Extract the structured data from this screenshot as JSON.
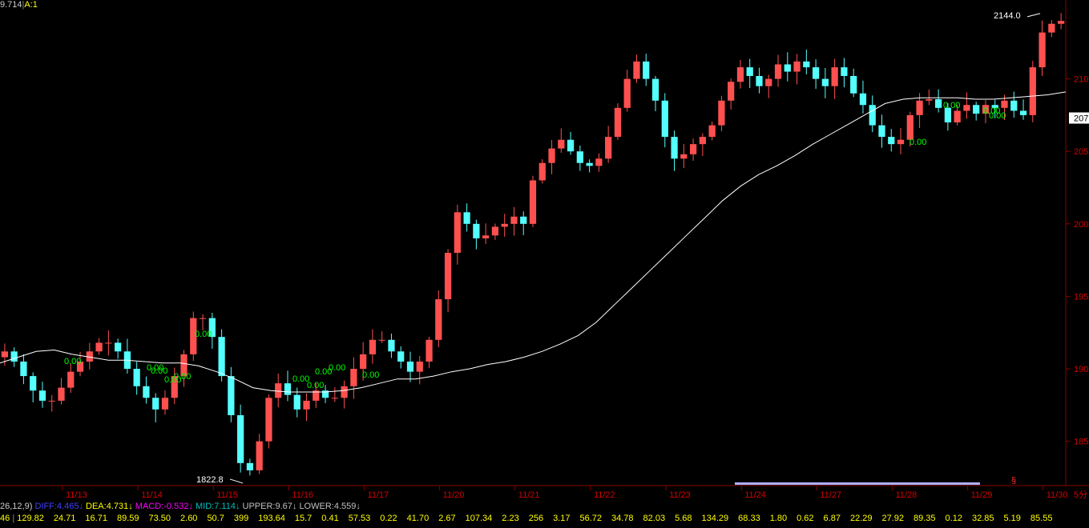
{
  "header": {
    "value_text": "9.714",
    "mode_text": "A:1"
  },
  "colors": {
    "up": "#ff5050",
    "down": "#54ffff",
    "ma": "#ffffff",
    "grid": "#8b0000",
    "axis_label": "#d40000",
    "marker": "#00ff00",
    "dif": "#4040ff",
    "dea": "#ffff00",
    "macd": "#ff00ff",
    "mid": "#00c0c0",
    "upper": "#c0c0c0",
    "lower": "#c0c0c0"
  },
  "chart_data": {
    "type": "line",
    "title": "",
    "xlabel": "",
    "ylabel": "",
    "x_ticks": [
      "11/13",
      "11/14",
      "11/15",
      "11/16",
      "11/17",
      "11/20",
      "11/21",
      "11/22",
      "11/23",
      "11/24",
      "11/27",
      "11/28",
      "11/29",
      "11/30"
    ],
    "y_ticks": [
      1850,
      1900,
      1950,
      2000,
      2050,
      2100
    ],
    "y_tick_labels": [
      "185",
      "190",
      "195",
      "200",
      "205",
      "210"
    ],
    "current_price_label": "207",
    "ylim": [
      1820,
      2150
    ],
    "series": [
      {
        "values": [
          1912,
          1905,
          1895,
          1885,
          1878,
          1878,
          1887,
          1898,
          1905,
          1912,
          1918,
          1918,
          1912,
          1900,
          1888,
          1880,
          1872,
          1880,
          1895,
          1910,
          1935,
          1935,
          1922,
          1895,
          1868,
          1835,
          1830,
          1850,
          1880,
          1890,
          1882,
          1872,
          1878,
          1885,
          1880,
          1880,
          1888,
          1900,
          1910,
          1920,
          1920,
          1912,
          1905,
          1898,
          1905,
          1920,
          1948,
          1980,
          2008,
          2000,
          1990,
          1992,
          1998,
          2000,
          2005,
          2000,
          2030,
          2042,
          2052,
          2058,
          2050,
          2042,
          2040,
          2045,
          2060,
          2080,
          2100,
          2112,
          2100,
          2085,
          2060,
          2045,
          2048,
          2055,
          2060,
          2068,
          2085,
          2098,
          2108,
          2102,
          2095,
          2100,
          2110,
          2105,
          2112,
          2108,
          2100,
          2095,
          2108,
          2102,
          2090,
          2082,
          2068,
          2060,
          2055,
          2058,
          2075,
          2085,
          2086,
          2080,
          2070,
          2078,
          2082,
          2076,
          2082,
          2080,
          2085,
          2078,
          2075,
          2108,
          2132,
          2138,
          2140
        ]
      },
      {
        "values": [
          1904,
          1908,
          1912,
          1913,
          1910,
          1908,
          1906,
          1906,
          1905,
          1904,
          1904,
          1902,
          1898,
          1893,
          1887,
          1885,
          1884,
          1884,
          1884,
          1885,
          1887,
          1890,
          1893,
          1893,
          1895,
          1898,
          1900,
          1903,
          1905,
          1908,
          1912,
          1917,
          1923,
          1932,
          1944,
          1956,
          1968,
          1980,
          1992,
          2004,
          2016,
          2026,
          2034,
          2040,
          2047,
          2055,
          2062,
          2069,
          2076,
          2083,
          2086,
          2087,
          2087,
          2087,
          2086,
          2086,
          2087,
          2088,
          2089,
          2091
        ]
      }
    ],
    "annotations": [
      {
        "text": "2144.0"
      },
      {
        "text": "1822.8"
      },
      {
        "text": "0.00"
      },
      {
        "text": "0.00"
      },
      {
        "text": "0.00"
      },
      {
        "text": "0.00"
      },
      {
        "text": "0.00"
      },
      {
        "text": "0.00"
      },
      {
        "text": "0.00"
      },
      {
        "text": "0.00"
      },
      {
        "text": "0.00"
      },
      {
        "text": "0.00"
      },
      {
        "text": "0.00"
      },
      {
        "text": "0.00"
      },
      {
        "text": "0.00"
      },
      {
        "text": "0.00"
      },
      {
        "text": "0.00"
      }
    ],
    "grid": false
  },
  "indicators": {
    "params": "26,12,9)",
    "dif": "DIFF:4.465",
    "dea": "DEA:4.731",
    "macd": "MACD:-0.532",
    "mid": "MID:7.114",
    "upper": "UPPER:9.67",
    "lower": "LOWER:4.559",
    "arrow_down": "↓",
    "separator": "|"
  },
  "value_row": {
    "first": "46",
    "separator": "|",
    "items": [
      "129.82",
      "24.71",
      "16.71",
      "89.59",
      "73.50",
      "2.60",
      "50.7",
      "399",
      "193.64",
      "15.7",
      "0.41",
      "57.53",
      "0.22",
      "41.70",
      "2.67",
      "107.34",
      "2.23",
      "256",
      "3.17",
      "56.72",
      "34.78",
      "82.03",
      "5.68",
      "134.29",
      "68.33",
      "1.80",
      "0.62",
      "6.87",
      "22.29",
      "27.92",
      "89.35",
      "0.12",
      "32.85",
      "5.19",
      "85.55"
    ]
  },
  "small_markers": {
    "s_marker": "§",
    "five_label": "5分"
  }
}
